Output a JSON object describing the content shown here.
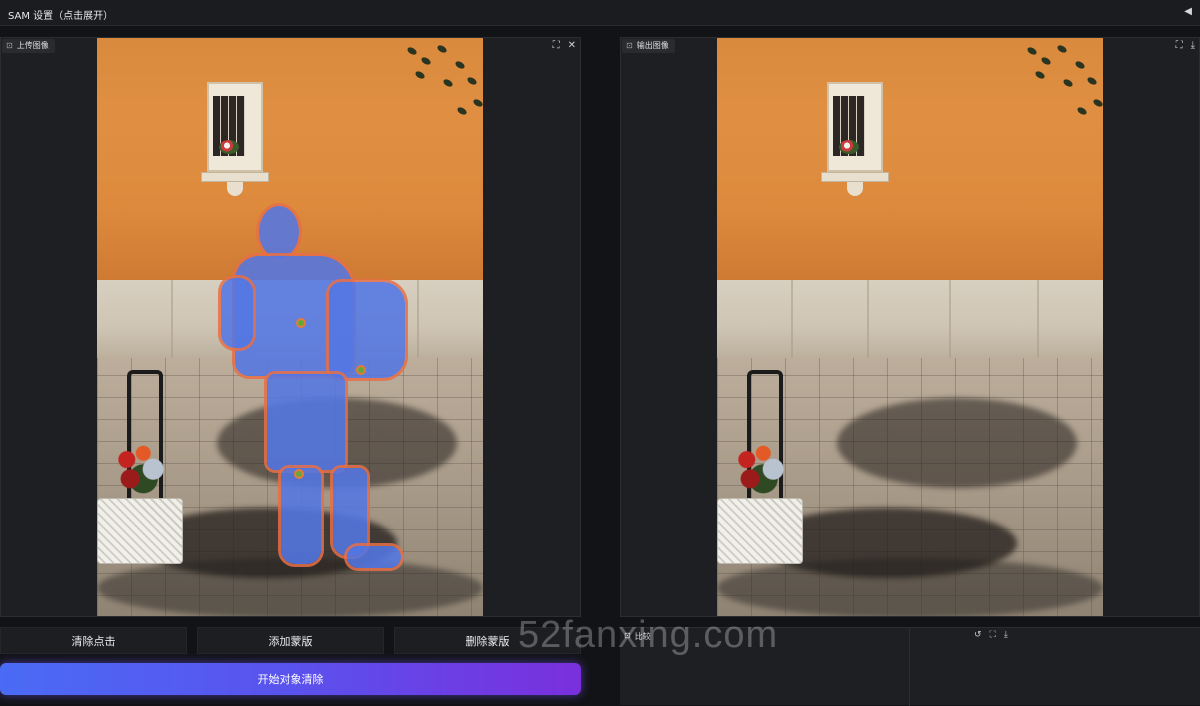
{
  "header": {
    "title": "SAM 设置（点击展开）",
    "collapse_icon": "◀"
  },
  "upload_panel": {
    "label": "上传图像",
    "icons": [
      "fullscreen-icon",
      "close-icon"
    ]
  },
  "output_panel": {
    "label": "输出图像",
    "icons": [
      "fullscreen-icon",
      "download-icon"
    ]
  },
  "buttons": {
    "clear_clicks": "清除点击",
    "add_mask": "添加蒙版",
    "delete_mask": "删除蒙版",
    "start_removal": "开始对象清除"
  },
  "compare_panel": {
    "label": "比较",
    "icons": [
      "reset-icon",
      "fullscreen-icon",
      "download-icon"
    ]
  },
  "watermark": "52fanxing.com",
  "colors": {
    "mask": "#5376e2",
    "mask_outline": "#e66e46",
    "point": "#65a83a",
    "primary_start": "#4a6bf5",
    "primary_end": "#7a2fdd"
  }
}
